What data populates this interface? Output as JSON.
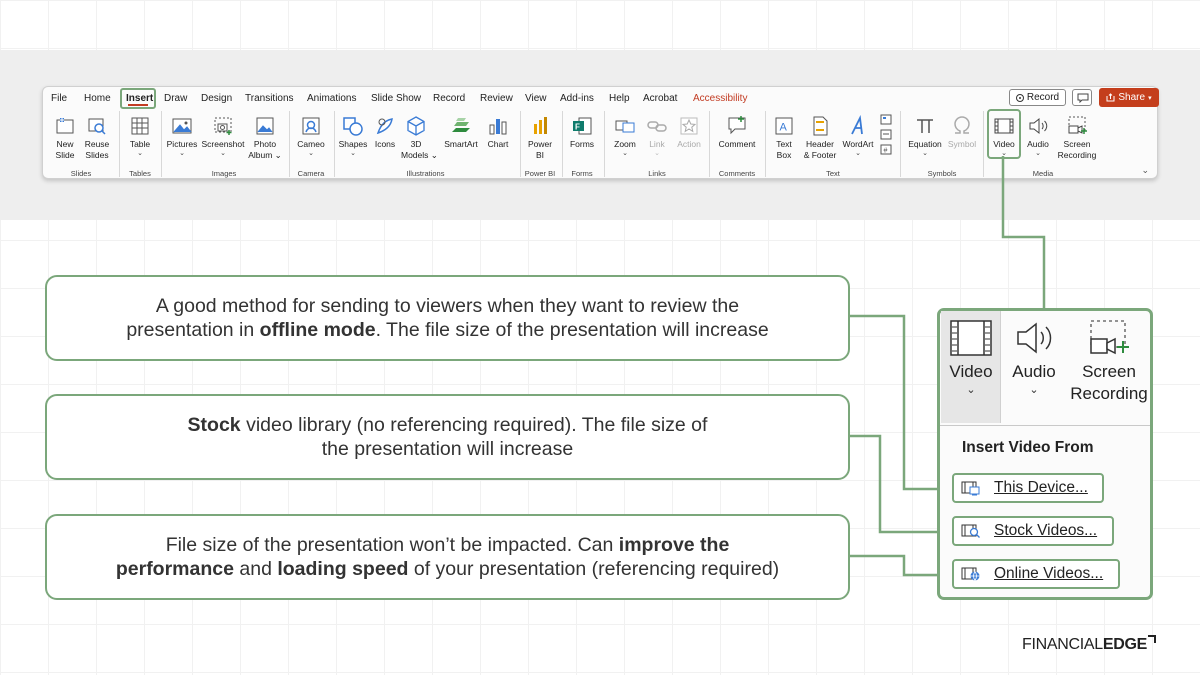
{
  "ribbon": {
    "tabs": [
      "File",
      "Home",
      "Insert",
      "Draw",
      "Design",
      "Transitions",
      "Animations",
      "Slide Show",
      "Record",
      "Review",
      "View",
      "Add-ins",
      "Help",
      "Acrobat",
      "Accessibility"
    ],
    "active_tab": "Insert",
    "record_label": "Record",
    "share_label": "Share",
    "commands": {
      "new_slide": [
        "New",
        "Slide"
      ],
      "reuse_slides": [
        "Reuse",
        "Slides"
      ],
      "table": "Table",
      "pictures": "Pictures",
      "screenshot": "Screenshot",
      "photo_album": [
        "Photo",
        "Album"
      ],
      "cameo": "Cameo",
      "shapes": "Shapes",
      "icons": "Icons",
      "models_3d": [
        "3D",
        "Models"
      ],
      "smartart": "SmartArt",
      "chart": "Chart",
      "power_bi": [
        "Power",
        "BI"
      ],
      "forms": "Forms",
      "zoom": "Zoom",
      "link": "Link",
      "action": "Action",
      "comment": "Comment",
      "text_box": [
        "Text",
        "Box"
      ],
      "header_footer": [
        "Header",
        "& Footer"
      ],
      "wordart": "WordArt",
      "equation": "Equation",
      "symbol": "Symbol",
      "video": "Video",
      "audio": "Audio",
      "screen_recording": [
        "Screen",
        "Recording"
      ]
    },
    "groups": {
      "slides": "Slides",
      "tables": "Tables",
      "images": "Images",
      "camera": "Camera",
      "illustrations": "Illustrations",
      "power_bi": "Power BI",
      "forms": "Forms",
      "links": "Links",
      "comments": "Comments",
      "text": "Text",
      "symbols": "Symbols",
      "media": "Media"
    }
  },
  "callouts": {
    "c1": {
      "line1": "A good method for sending to viewers when they want to review the",
      "line2_pre": "presentation in ",
      "line2_bold": "offline mode",
      "line2_post": ". The file size of the presentation will increase"
    },
    "c2": {
      "line1_bold": "Stock",
      "line1_post": " video library (no referencing required). The file size of",
      "line2": "the presentation will increase"
    },
    "c3": {
      "line1_pre": "File size of the presentation won’t be impacted. Can ",
      "line1_bold": "improve the",
      "line2_bold1": "performance",
      "line2_mid": " and ",
      "line2_bold2": "loading speed",
      "line2_post": " of your presentation (referencing required)"
    }
  },
  "zoom_panel": {
    "video": "Video",
    "audio": "Audio",
    "screen": "Screen",
    "recording": "Recording",
    "menu_title": "Insert Video From",
    "items": [
      "This Device...",
      "Stock Videos...",
      "Online Videos..."
    ]
  },
  "brand": {
    "light": "FINANCIAL",
    "bold": "EDGE"
  },
  "colors": {
    "highlight": "#7ba77b",
    "share": "#c43e1c",
    "accessibility": "#c23b22"
  }
}
